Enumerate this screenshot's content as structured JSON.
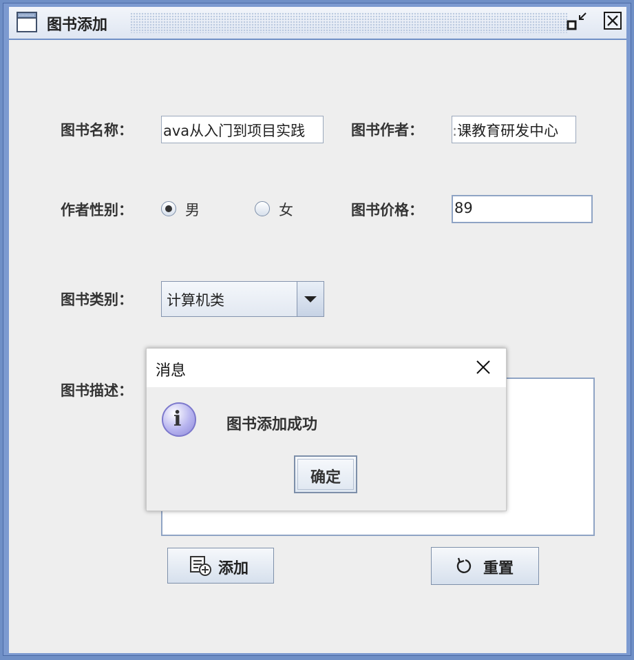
{
  "window": {
    "title": "图书添加"
  },
  "form": {
    "book_name_label": "图书名称：",
    "book_name_value": "ava从入门到项目实践",
    "author_label": "图书作者：",
    "author_value": "课教育研发中心",
    "author_gender_label": "作者性别：",
    "male_label": "男",
    "female_label": "女",
    "price_label": "图书价格：",
    "price_value": "89",
    "category_label": "图书类别：",
    "category_value": "计算机类",
    "description_label": "图书描述："
  },
  "buttons": {
    "add_label": "添加",
    "reset_label": "重置"
  },
  "dialog": {
    "title": "消息",
    "message": "图书添加成功",
    "ok_label": "确定"
  }
}
